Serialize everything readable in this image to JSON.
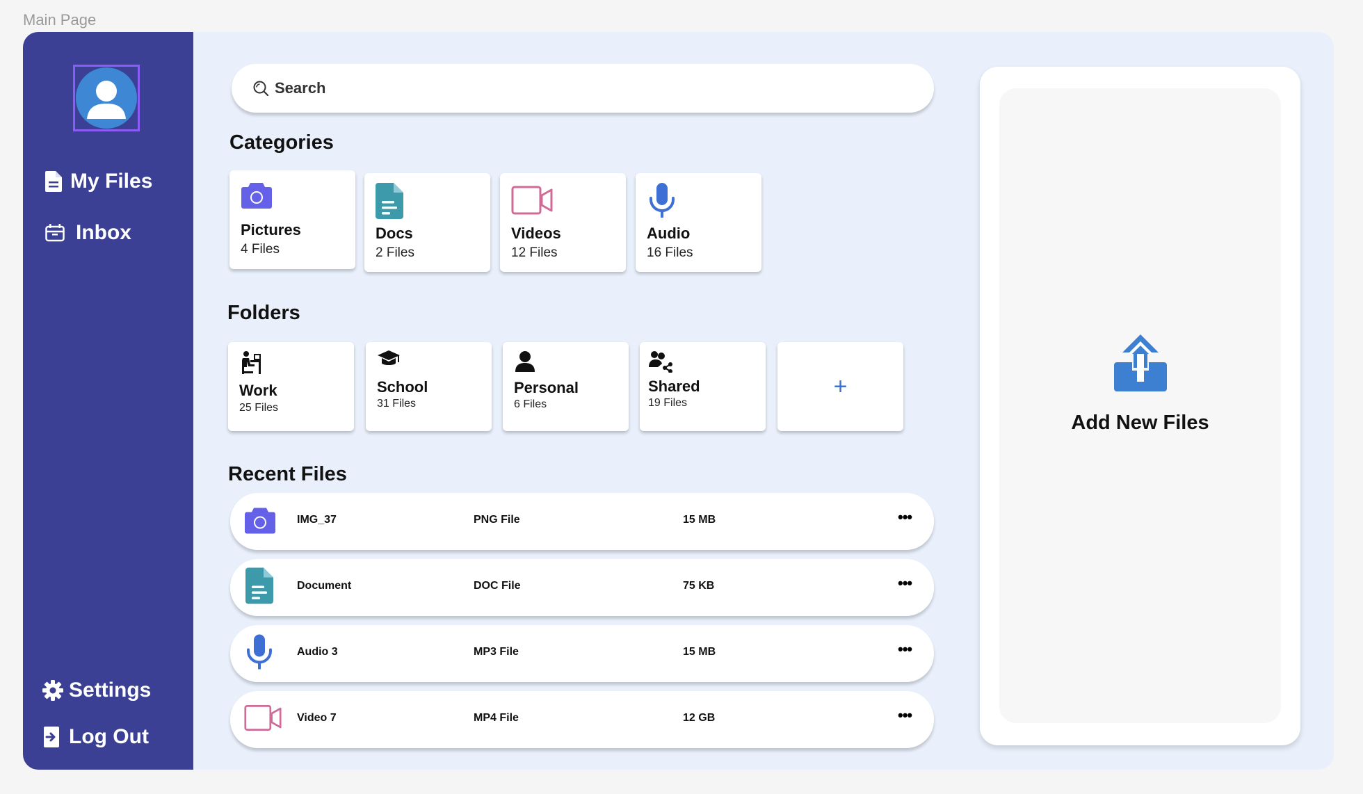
{
  "frame_label": "Main Page",
  "colors": {
    "sidebar": "#3b4095",
    "background": "#e9f0fb",
    "pictures": "#6460e8",
    "docs": "#3c9aab",
    "videos": "#d06a96",
    "audio": "#3d6fd4",
    "upload": "#3d7fd0"
  },
  "sidebar": {
    "avatar_icon": "user-icon",
    "nav": [
      {
        "label": "My Files",
        "icon": "file-icon"
      },
      {
        "label": "Inbox",
        "icon": "inbox-icon"
      }
    ],
    "bottom": [
      {
        "label": "Settings",
        "icon": "gear-icon"
      },
      {
        "label": "Log Out",
        "icon": "logout-icon"
      }
    ]
  },
  "search": {
    "placeholder": "Search",
    "icon": "search-icon"
  },
  "categories": {
    "title": "Categories",
    "items": [
      {
        "name": "Pictures",
        "count": "4 Files",
        "icon": "camera-icon"
      },
      {
        "name": "Docs",
        "count": "2 Files",
        "icon": "document-icon"
      },
      {
        "name": "Videos",
        "count": "12 Files",
        "icon": "video-camera-icon"
      },
      {
        "name": "Audio",
        "count": "16 Files",
        "icon": "microphone-icon"
      }
    ]
  },
  "folders": {
    "title": "Folders",
    "items": [
      {
        "name": "Work",
        "count": "25 Files",
        "icon": "desk-worker-icon"
      },
      {
        "name": "School",
        "count": "31 Files",
        "icon": "graduation-cap-icon"
      },
      {
        "name": "Personal",
        "count": "6 Files",
        "icon": "person-icon"
      },
      {
        "name": "Shared",
        "count": "19 Files",
        "icon": "users-share-icon"
      }
    ],
    "add_label": "+"
  },
  "recent": {
    "title": "Recent Files",
    "rows": [
      {
        "name": "IMG_37",
        "type": "PNG File",
        "size": "15 MB",
        "icon": "camera-icon",
        "more": "•••"
      },
      {
        "name": "Document",
        "type": "DOC File",
        "size": "75 KB",
        "icon": "document-icon",
        "more": "•••"
      },
      {
        "name": "Audio 3",
        "type": "MP3 File",
        "size": "15 MB",
        "icon": "microphone-icon",
        "more": "•••"
      },
      {
        "name": "Video 7",
        "type": "MP4 File",
        "size": "12 GB",
        "icon": "video-camera-icon",
        "more": "•••"
      }
    ]
  },
  "upload": {
    "label": "Add New Files",
    "icon": "upload-icon"
  }
}
